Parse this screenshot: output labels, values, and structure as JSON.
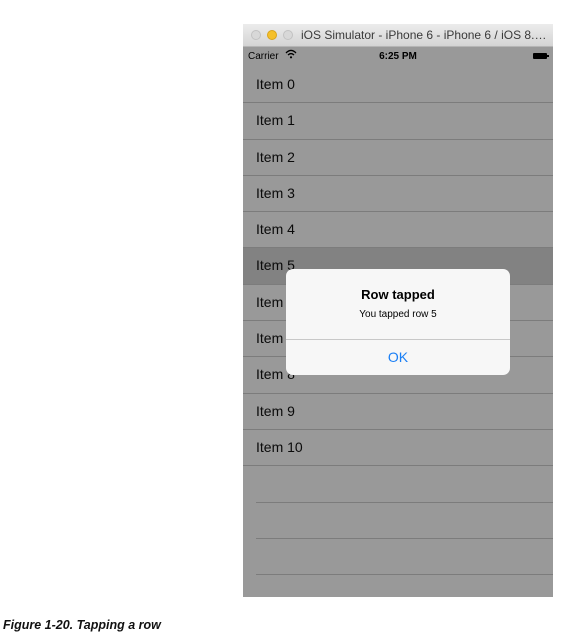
{
  "window": {
    "title": "iOS Simulator - iPhone 6 - iPhone 6 / iOS 8.3..."
  },
  "status_bar": {
    "carrier": "Carrier",
    "time": "6:25 PM",
    "icons": [
      "wifi-icon",
      "battery-icon"
    ]
  },
  "table": {
    "items": [
      {
        "label": "Item 0"
      },
      {
        "label": "Item 1"
      },
      {
        "label": "Item 2"
      },
      {
        "label": "Item 3"
      },
      {
        "label": "Item 4"
      },
      {
        "label": "Item 5",
        "selected": true
      },
      {
        "label": "Item 6"
      },
      {
        "label": "Item 7"
      },
      {
        "label": "Item 8"
      },
      {
        "label": "Item 9"
      },
      {
        "label": "Item 10"
      }
    ],
    "empty_rows": 4
  },
  "alert": {
    "title": "Row tapped",
    "message": "You tapped row 5",
    "button": "OK"
  },
  "caption": "Figure 1-20.  Tapping a row",
  "colors": {
    "accent": "#1a7ff5",
    "selected_row": "#d9d9d9",
    "overlay": "rgba(0,0,0,0.40)"
  }
}
